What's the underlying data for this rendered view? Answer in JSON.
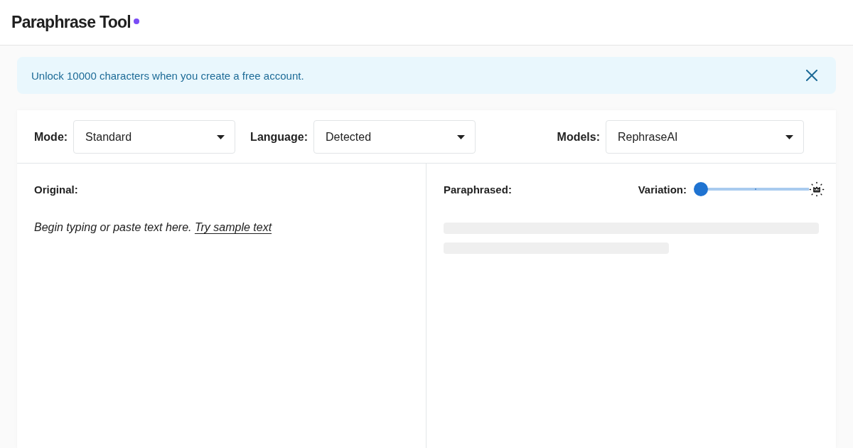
{
  "header": {
    "title": "Paraphrase Tool"
  },
  "banner": {
    "message": "Unlock 10000 characters when you create a free account."
  },
  "toolbar": {
    "selects": [
      {
        "label": "Mode:",
        "value": "Standard"
      },
      {
        "label": "Language:",
        "value": "Detected"
      },
      {
        "label": "Models:",
        "value": "RephraseAI"
      }
    ]
  },
  "original": {
    "heading": "Original:",
    "placeholder": "Begin typing or paste text here.",
    "sample_link": "Try sample text"
  },
  "paraphrased": {
    "heading": "Paraphrased:",
    "variation": {
      "label": "Variation:",
      "level": 0
    }
  }
}
